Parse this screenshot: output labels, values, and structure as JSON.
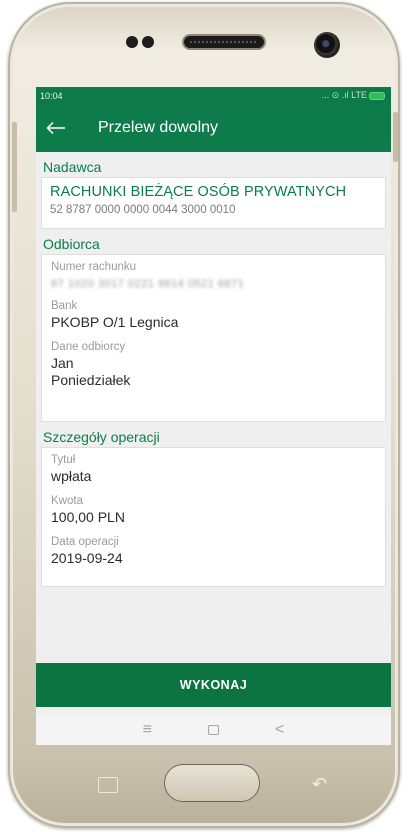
{
  "status_bar": {
    "time": "10:04",
    "indicators": "... ⊙ .ıl LTE"
  },
  "app_bar": {
    "title": "Przelew dowolny",
    "back_icon": "arrow-left-icon"
  },
  "sender": {
    "header": "Nadawca",
    "account_name": "RACHUNKI BIEŻĄCE OSÓB PRYWATNYCH",
    "account_number": "52 8787 0000 0000 0044 3000 0010"
  },
  "recipient": {
    "header": "Odbiorca",
    "account_label": "Numer rachunku",
    "account_value": "67 1020 3017 0221 9814 0521 6871",
    "bank_label": "Bank",
    "bank_value": "PKOBP O/1 Legnica",
    "data_label": "Dane odbiorcy",
    "data_line1": "Jan",
    "data_line2": "Poniedziałek"
  },
  "details": {
    "header": "Szczegóły operacji",
    "title_label": "Tytuł",
    "title_value": "wpłata",
    "amount_label": "Kwota",
    "amount_value": "100,00 PLN",
    "date_label": "Data operacji",
    "date_value": "2019-09-24"
  },
  "actions": {
    "execute_label": "WYKONAJ"
  },
  "nav_bar": {
    "menu_icon": "≡",
    "back_icon": "<"
  }
}
